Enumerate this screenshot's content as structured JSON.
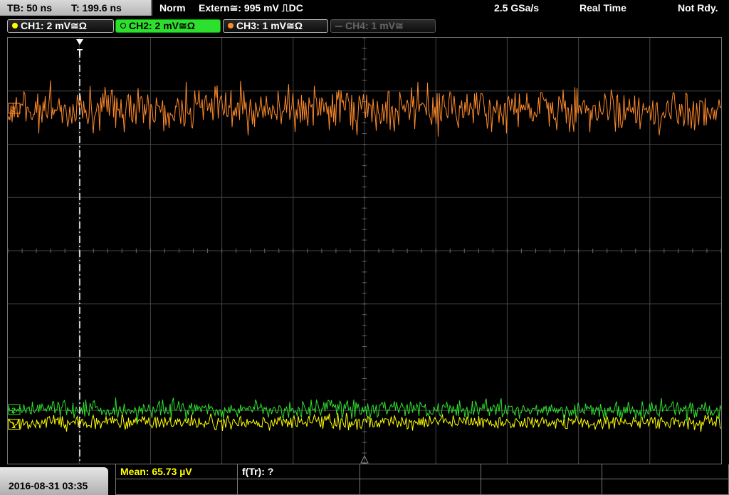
{
  "status": {
    "timebase": "TB: 50 ns",
    "trigger_time": "T: 199.6 ns",
    "mode": "Norm",
    "trigger": "Extern≅: 995 mV ⎍DC",
    "sample_rate": "2.5 GSa/s",
    "acquisition": "Real Time",
    "state": "Not Rdy."
  },
  "channels": [
    {
      "label": "CH1: 2 mV≅Ω",
      "color": "#ffff00",
      "active": false,
      "enabled": true
    },
    {
      "label": "CH2: 2 mV≅Ω",
      "color": "#2ee02e",
      "active": true,
      "enabled": true
    },
    {
      "label": "CH3: 1 mV≅Ω",
      "color": "#ff8a2a",
      "active": false,
      "enabled": true
    },
    {
      "label": "CH4: 1 mV≅",
      "color": "#666666",
      "active": false,
      "enabled": false
    }
  ],
  "screen": {
    "trigger_marker": "T",
    "ch3_marker": "3",
    "ch2_marker": "2",
    "ch1_marker": "1"
  },
  "measurements": {
    "mean": "Mean: 65.73 µV",
    "ftr": "f(Tr): ?"
  },
  "datetime": "2016-08-31 03:35",
  "colors": {
    "ch1": "#ffff00",
    "ch2": "#2ee02e",
    "ch3": "#ff8a2a",
    "grid": "#444444"
  }
}
